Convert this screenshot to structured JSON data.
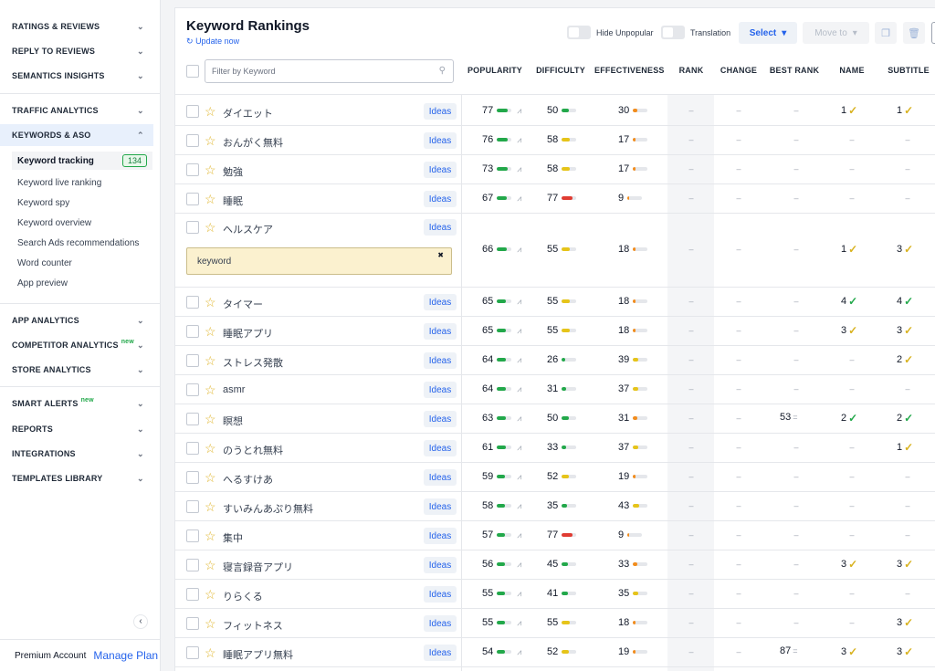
{
  "sidebar": {
    "sections_top": [
      {
        "label": "RATINGS & REVIEWS"
      },
      {
        "label": "REPLY TO REVIEWS"
      },
      {
        "label": "SEMANTICS INSIGHTS"
      },
      {
        "label": "TRAFFIC ANALYTICS"
      },
      {
        "label": "KEYWORDS & ASO"
      }
    ],
    "sub_items": [
      {
        "label": "Keyword tracking",
        "badge": "134"
      },
      {
        "label": "Keyword live ranking"
      },
      {
        "label": "Keyword spy"
      },
      {
        "label": "Keyword overview"
      },
      {
        "label": "Search Ads recommendations"
      },
      {
        "label": "Word counter"
      },
      {
        "label": "App preview"
      }
    ],
    "sections_bottom": [
      {
        "label": "APP ANALYTICS",
        "new": ""
      },
      {
        "label": "COMPETITOR ANALYTICS",
        "new": "new"
      },
      {
        "label": "STORE ANALYTICS",
        "new": ""
      },
      {
        "label": "SMART ALERTS",
        "new": "new"
      },
      {
        "label": "REPORTS",
        "new": ""
      },
      {
        "label": "INTEGRATIONS",
        "new": ""
      },
      {
        "label": "TEMPLATES LIBRARY",
        "new": ""
      }
    ],
    "footer": {
      "account": "Premium Account",
      "plan_link": "Manage Plan"
    }
  },
  "main": {
    "title": "Keyword Rankings",
    "update": "Update now",
    "toggles": {
      "hide_unpopular": "Hide Unpopular",
      "translation": "Translation"
    },
    "select_label": "Select",
    "move_label": "Move to",
    "filter_placeholder": "Filter by Keyword",
    "columns": {
      "popularity": "POPULARITY",
      "difficulty": "DIFFICULTY",
      "effectiveness": "EFFECTIVENESS",
      "rank": "RANK",
      "change": "CHANGE",
      "best_rank": "BEST RANK",
      "name": "NAME",
      "subtitle": "SUBTITLE"
    },
    "ideas_label": "Ideas",
    "dash": "–",
    "tooltip_text": "keyword",
    "tooltip_close": "✖",
    "colors": {
      "green": "#22a84a",
      "yellow": "#e6c419",
      "red": "#e03c32",
      "orange": "#f28c1c",
      "accent": "#2563eb"
    },
    "rows": [
      {
        "kw": "ダイエット",
        "pop": "77",
        "pop_c": "green",
        "pop_f": 0.77,
        "diff": "50",
        "diff_c": "green",
        "diff_f": 0.5,
        "eff": "30",
        "eff_c": "orange",
        "eff_f": 0.3,
        "best": "",
        "name": "1",
        "name_ck": "y",
        "sub": "1",
        "sub_ck": "y"
      },
      {
        "kw": "おんがく無料",
        "pop": "76",
        "pop_c": "green",
        "pop_f": 0.76,
        "diff": "58",
        "diff_c": "yellow",
        "diff_f": 0.58,
        "eff": "17",
        "eff_c": "orange",
        "eff_f": 0.17,
        "best": "",
        "name": "",
        "name_ck": "",
        "sub": "",
        "sub_ck": ""
      },
      {
        "kw": "勉強",
        "pop": "73",
        "pop_c": "green",
        "pop_f": 0.73,
        "diff": "58",
        "diff_c": "yellow",
        "diff_f": 0.58,
        "eff": "17",
        "eff_c": "orange",
        "eff_f": 0.17,
        "best": "",
        "name": "",
        "name_ck": "",
        "sub": "",
        "sub_ck": ""
      },
      {
        "kw": "睡眠",
        "pop": "67",
        "pop_c": "green",
        "pop_f": 0.67,
        "diff": "77",
        "diff_c": "red",
        "diff_f": 0.77,
        "eff": "9",
        "eff_c": "orange",
        "eff_f": 0.09,
        "best": "",
        "name": "",
        "name_ck": "",
        "sub": "",
        "sub_ck": ""
      },
      {
        "kw": "ヘルスケア",
        "pop": "66",
        "pop_c": "green",
        "pop_f": 0.66,
        "diff": "55",
        "diff_c": "yellow",
        "diff_f": 0.55,
        "eff": "18",
        "eff_c": "orange",
        "eff_f": 0.18,
        "best": "",
        "name": "1",
        "name_ck": "y",
        "sub": "3",
        "sub_ck": "y"
      },
      {
        "kw": "タイマー",
        "pop": "65",
        "pop_c": "green",
        "pop_f": 0.65,
        "diff": "55",
        "diff_c": "yellow",
        "diff_f": 0.55,
        "eff": "18",
        "eff_c": "orange",
        "eff_f": 0.18,
        "best": "",
        "name": "4",
        "name_ck": "g",
        "sub": "4",
        "sub_ck": "g"
      },
      {
        "kw": "睡眠アプリ",
        "pop": "65",
        "pop_c": "green",
        "pop_f": 0.65,
        "diff": "55",
        "diff_c": "yellow",
        "diff_f": 0.55,
        "eff": "18",
        "eff_c": "orange",
        "eff_f": 0.18,
        "best": "",
        "name": "3",
        "name_ck": "y",
        "sub": "3",
        "sub_ck": "y"
      },
      {
        "kw": "ストレス発散",
        "pop": "64",
        "pop_c": "green",
        "pop_f": 0.64,
        "diff": "26",
        "diff_c": "green",
        "diff_f": 0.26,
        "eff": "39",
        "eff_c": "yellow",
        "eff_f": 0.39,
        "best": "",
        "name": "",
        "name_ck": "",
        "sub": "2",
        "sub_ck": "y"
      },
      {
        "kw": "asmr",
        "pop": "64",
        "pop_c": "green",
        "pop_f": 0.64,
        "diff": "31",
        "diff_c": "green",
        "diff_f": 0.31,
        "eff": "37",
        "eff_c": "yellow",
        "eff_f": 0.37,
        "best": "",
        "name": "",
        "name_ck": "",
        "sub": "",
        "sub_ck": ""
      },
      {
        "kw": "瞑想",
        "pop": "63",
        "pop_c": "green",
        "pop_f": 0.63,
        "diff": "50",
        "diff_c": "green",
        "diff_f": 0.5,
        "eff": "31",
        "eff_c": "orange",
        "eff_f": 0.31,
        "best": "53",
        "name": "2",
        "name_ck": "g",
        "sub": "2",
        "sub_ck": "g"
      },
      {
        "kw": "のうとれ無料",
        "pop": "61",
        "pop_c": "green",
        "pop_f": 0.61,
        "diff": "33",
        "diff_c": "green",
        "diff_f": 0.33,
        "eff": "37",
        "eff_c": "yellow",
        "eff_f": 0.37,
        "best": "",
        "name": "",
        "name_ck": "",
        "sub": "1",
        "sub_ck": "y"
      },
      {
        "kw": "へるすけあ",
        "pop": "59",
        "pop_c": "green",
        "pop_f": 0.59,
        "diff": "52",
        "diff_c": "yellow",
        "diff_f": 0.52,
        "eff": "19",
        "eff_c": "orange",
        "eff_f": 0.19,
        "best": "",
        "name": "",
        "name_ck": "",
        "sub": "",
        "sub_ck": ""
      },
      {
        "kw": "すいみんあぷり無料",
        "pop": "58",
        "pop_c": "green",
        "pop_f": 0.58,
        "diff": "35",
        "diff_c": "green",
        "diff_f": 0.35,
        "eff": "43",
        "eff_c": "yellow",
        "eff_f": 0.43,
        "best": "",
        "name": "",
        "name_ck": "",
        "sub": "",
        "sub_ck": ""
      },
      {
        "kw": "集中",
        "pop": "57",
        "pop_c": "green",
        "pop_f": 0.57,
        "diff": "77",
        "diff_c": "red",
        "diff_f": 0.77,
        "eff": "9",
        "eff_c": "orange",
        "eff_f": 0.09,
        "best": "",
        "name": "",
        "name_ck": "",
        "sub": "",
        "sub_ck": ""
      },
      {
        "kw": "寝言録音アプリ",
        "pop": "56",
        "pop_c": "green",
        "pop_f": 0.56,
        "diff": "45",
        "diff_c": "green",
        "diff_f": 0.45,
        "eff": "33",
        "eff_c": "orange",
        "eff_f": 0.33,
        "best": "",
        "name": "3",
        "name_ck": "y",
        "sub": "3",
        "sub_ck": "y"
      },
      {
        "kw": "りらくる",
        "pop": "55",
        "pop_c": "green",
        "pop_f": 0.55,
        "diff": "41",
        "diff_c": "green",
        "diff_f": 0.41,
        "eff": "35",
        "eff_c": "yellow",
        "eff_f": 0.35,
        "best": "",
        "name": "",
        "name_ck": "",
        "sub": "",
        "sub_ck": ""
      },
      {
        "kw": "フィットネス",
        "pop": "55",
        "pop_c": "green",
        "pop_f": 0.55,
        "diff": "55",
        "diff_c": "yellow",
        "diff_f": 0.55,
        "eff": "18",
        "eff_c": "orange",
        "eff_f": 0.18,
        "best": "",
        "name": "",
        "name_ck": "",
        "sub": "3",
        "sub_ck": "y"
      },
      {
        "kw": "睡眠アプリ無料",
        "pop": "54",
        "pop_c": "green",
        "pop_f": 0.54,
        "diff": "52",
        "diff_c": "yellow",
        "diff_f": 0.52,
        "eff": "19",
        "eff_c": "orange",
        "eff_f": 0.19,
        "best": "87",
        "name": "3",
        "name_ck": "y",
        "sub": "3",
        "sub_ck": "y"
      }
    ]
  }
}
